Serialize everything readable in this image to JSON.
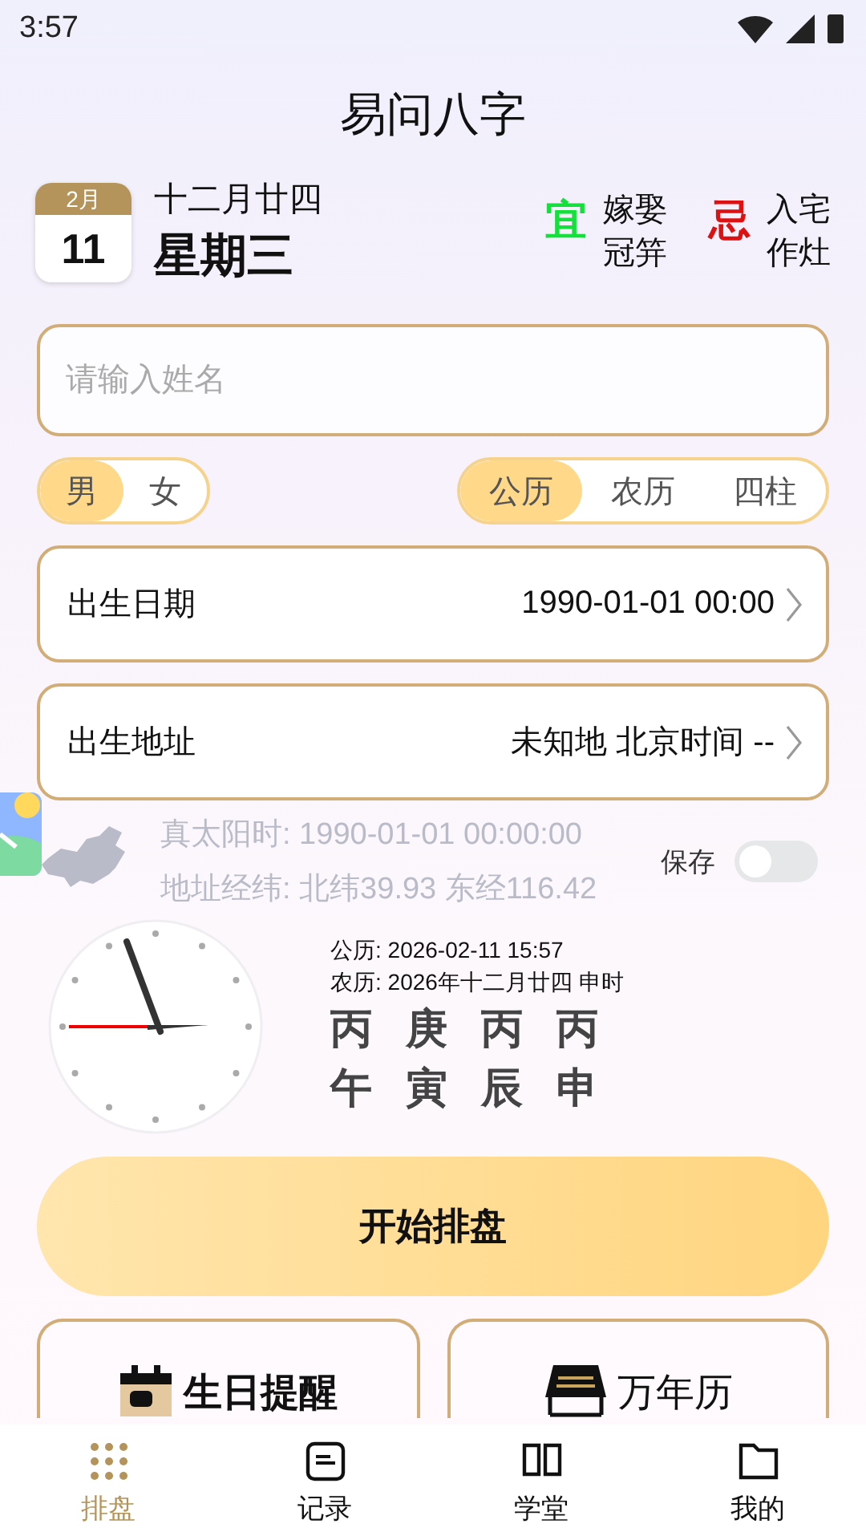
{
  "status_bar": {
    "time": "3:57"
  },
  "title": "易问八字",
  "date": {
    "month": "2月",
    "day": "11",
    "lunar": "十二月廿四",
    "weekday": "星期三"
  },
  "almanac": [
    {
      "kind": "good",
      "label": "宜",
      "items": [
        "嫁娶",
        "冠笄"
      ]
    },
    {
      "kind": "bad",
      "label": "忌",
      "items": [
        "入宅",
        "作灶"
      ]
    }
  ],
  "name_field": {
    "placeholder": "请输入姓名"
  },
  "gender": [
    {
      "label": "男",
      "selected": true
    },
    {
      "label": "女",
      "selected": false
    }
  ],
  "calendar_type": [
    {
      "label": "公历",
      "selected": true
    },
    {
      "label": "农历",
      "selected": false
    },
    {
      "label": "四柱",
      "selected": false
    }
  ],
  "fields": [
    {
      "label": "出生日期",
      "value": "1990-01-01 00:00"
    },
    {
      "label": "出生地址",
      "value": "未知地 北京时间 --"
    }
  ],
  "solar_info": [
    "真太阳时: 1990-01-01 00:00:00",
    "地址经纬: 北纬39.93 东经116.42"
  ],
  "save": {
    "label": "保存",
    "on": false
  },
  "now": {
    "gregorian": "公历: 2026-02-11 15:57",
    "lunar": "农历: 2026年十二月廿四 申时",
    "stems": [
      "丙",
      "庚",
      "丙",
      "丙"
    ],
    "branches": [
      "午",
      "寅",
      "辰",
      "申"
    ]
  },
  "start_button": "开始排盘",
  "shortcuts": [
    {
      "kind": "reminder",
      "label": "生日提醒"
    },
    {
      "kind": "calendar",
      "label": "万年历"
    }
  ],
  "tabs": [
    {
      "kind": "chart",
      "label": "排盘",
      "selected": true
    },
    {
      "kind": "records",
      "label": "记录",
      "selected": false
    },
    {
      "kind": "school",
      "label": "学堂",
      "selected": false
    },
    {
      "kind": "me",
      "label": "我的",
      "selected": false
    }
  ]
}
